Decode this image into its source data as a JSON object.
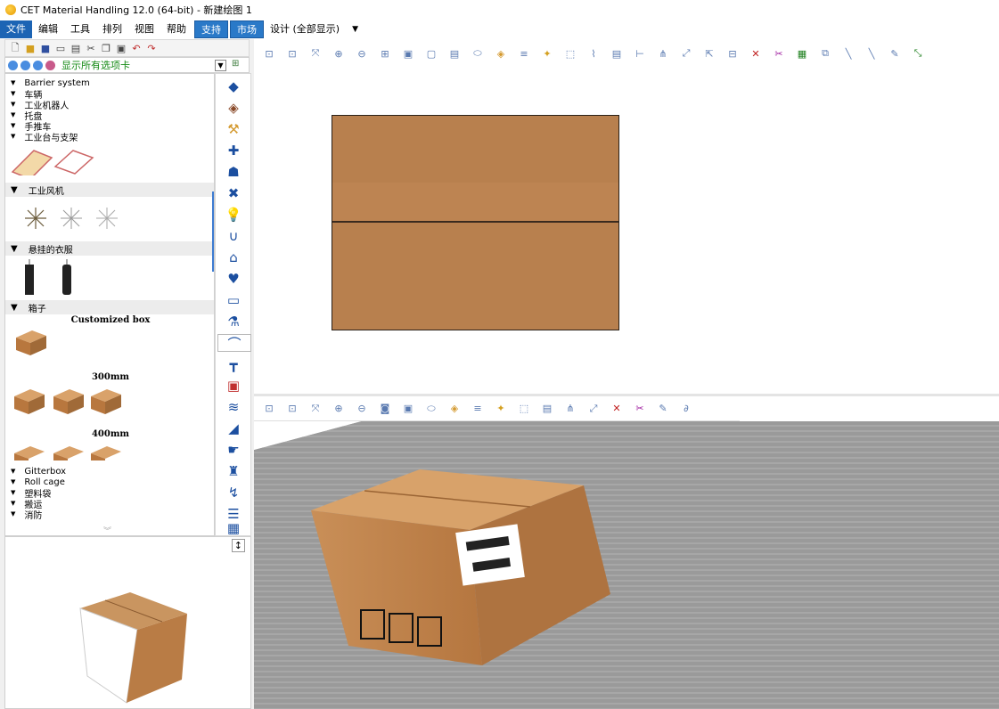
{
  "window": {
    "title": "CET Material Handling 12.0 (64-bit) - 新建绘图 1"
  },
  "menu": {
    "items": [
      "文件",
      "编辑",
      "工具",
      "排列",
      "视图",
      "帮助"
    ],
    "support": "支持",
    "market": "市场",
    "design": "设计 (全部显示)",
    "caret": "▼"
  },
  "tabbar": {
    "label": "显示所有选项卡"
  },
  "catalog": {
    "categories_top": [
      "Barrier system",
      "车辆",
      "工业机器人",
      "托盘",
      "手推车",
      "工业台与支架"
    ],
    "section_fans": "工业风机",
    "section_clothes": "悬挂的衣服",
    "section_boxes": "箱子",
    "box_groups": [
      "Customized box",
      "300mm",
      "400mm"
    ],
    "categories_bottom": [
      "Gitterbox",
      "Roll cage",
      "塑料袋",
      "搬运",
      "消防"
    ]
  },
  "colors": {
    "accent": "#1c64b4",
    "box": "#b8804e",
    "floor": "#9c9c9c"
  }
}
